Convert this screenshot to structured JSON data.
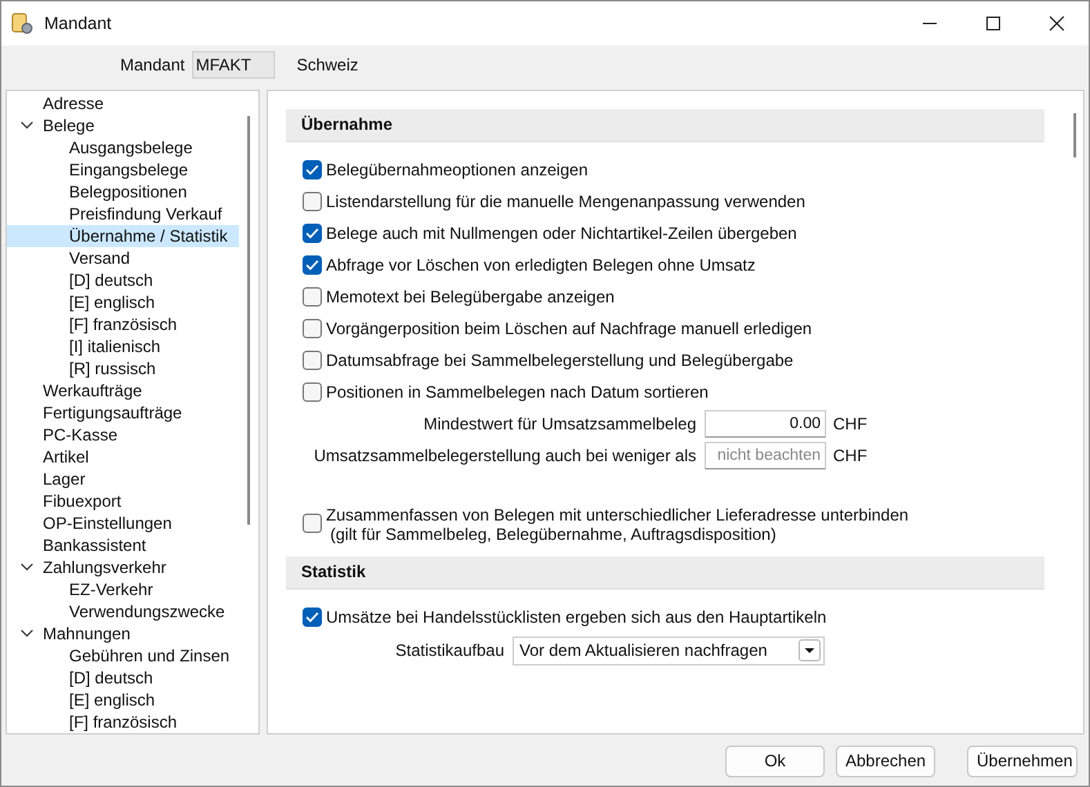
{
  "window": {
    "title": "Mandant"
  },
  "mandant": {
    "label": "Mandant",
    "value": "MFAKT",
    "country": "Schweiz"
  },
  "tree": [
    {
      "label": "Adresse",
      "selected": false
    },
    {
      "label": "Belege",
      "selected": false,
      "expanded": true,
      "children": [
        {
          "label": "Ausgangsbelege",
          "selected": false
        },
        {
          "label": "Eingangsbelege",
          "selected": false
        },
        {
          "label": "Belegpositionen",
          "selected": false
        },
        {
          "label": "Preisfindung Verkauf",
          "selected": false
        },
        {
          "label": "Übernahme / Statistik",
          "selected": true
        },
        {
          "label": "Versand",
          "selected": false
        },
        {
          "label": "[D]  deutsch",
          "selected": false
        },
        {
          "label": "[E]  englisch",
          "selected": false
        },
        {
          "label": "[F]  französisch",
          "selected": false
        },
        {
          "label": "[I]  italienisch",
          "selected": false
        },
        {
          "label": "[R]  russisch",
          "selected": false
        }
      ]
    },
    {
      "label": "Werkaufträge",
      "selected": false
    },
    {
      "label": "Fertigungsaufträge",
      "selected": false
    },
    {
      "label": "PC-Kasse",
      "selected": false
    },
    {
      "label": "Artikel",
      "selected": false
    },
    {
      "label": "Lager",
      "selected": false
    },
    {
      "label": "Fibuexport",
      "selected": false
    },
    {
      "label": "OP-Einstellungen",
      "selected": false
    },
    {
      "label": "Bankassistent",
      "selected": false
    },
    {
      "label": "Zahlungsverkehr",
      "selected": false,
      "expanded": true,
      "children": [
        {
          "label": "EZ-Verkehr",
          "selected": false
        },
        {
          "label": "Verwendungszwecke",
          "selected": false
        }
      ]
    },
    {
      "label": "Mahnungen",
      "selected": false,
      "expanded": true,
      "children": [
        {
          "label": "Gebühren und Zinsen",
          "selected": false
        },
        {
          "label": "[D]  deutsch",
          "selected": false
        },
        {
          "label": "[E]  englisch",
          "selected": false
        },
        {
          "label": "[F]  französisch",
          "selected": false
        }
      ]
    }
  ],
  "sections": [
    {
      "title": "Übernahme",
      "items": [
        {
          "kind": "checkbox",
          "label": "Belegübernahmeoptionen anzeigen",
          "checked": true
        },
        {
          "kind": "checkbox",
          "label": "Listendarstellung für die manuelle Mengenanpassung verwenden",
          "checked": false
        },
        {
          "kind": "checkbox",
          "label": "Belege auch mit Nullmengen oder Nichtartikel-Zeilen übergeben",
          "checked": true
        },
        {
          "kind": "checkbox",
          "label": "Abfrage vor Löschen von erledigten Belegen ohne Umsatz",
          "checked": true
        },
        {
          "kind": "checkbox",
          "label": "Memotext bei Belegübergabe anzeigen",
          "checked": false
        },
        {
          "kind": "checkbox",
          "label": "Vorgängerposition beim Löschen auf Nachfrage manuell erledigen",
          "checked": false
        },
        {
          "kind": "checkbox",
          "label": "Datumsabfrage bei Sammelbelegerstellung und Belegübergabe",
          "checked": false
        },
        {
          "kind": "checkbox",
          "label": "Positionen in Sammelbelegen nach Datum sortieren",
          "checked": false
        },
        {
          "kind": "amount",
          "label": "Mindestwert für Umsatzsammelbeleg",
          "value": "0.00",
          "unit": "CHF"
        },
        {
          "kind": "amount",
          "label": "Umsatzsammelbelegerstellung auch bei weniger als",
          "placeholder": "nicht beachten",
          "unit": "CHF"
        },
        {
          "kind": "checkbox",
          "label": "Zusammenfassen von Belegen mit unterschiedlicher Lieferadresse unterbinden",
          "note": "(gilt für Sammelbeleg, Belegübernahme, Auftragsdisposition)",
          "checked": false
        }
      ]
    },
    {
      "title": "Statistik",
      "items": [
        {
          "kind": "checkbox",
          "label": "Umsätze bei Handelsstücklisten ergeben sich aus den Hauptartikeln",
          "checked": true
        },
        {
          "kind": "select",
          "label": "Statistikaufbau",
          "value": "Vor dem Aktualisieren nachfragen"
        }
      ]
    }
  ],
  "buttons": [
    "Ok",
    "Abbrechen",
    "Übernehmen"
  ]
}
